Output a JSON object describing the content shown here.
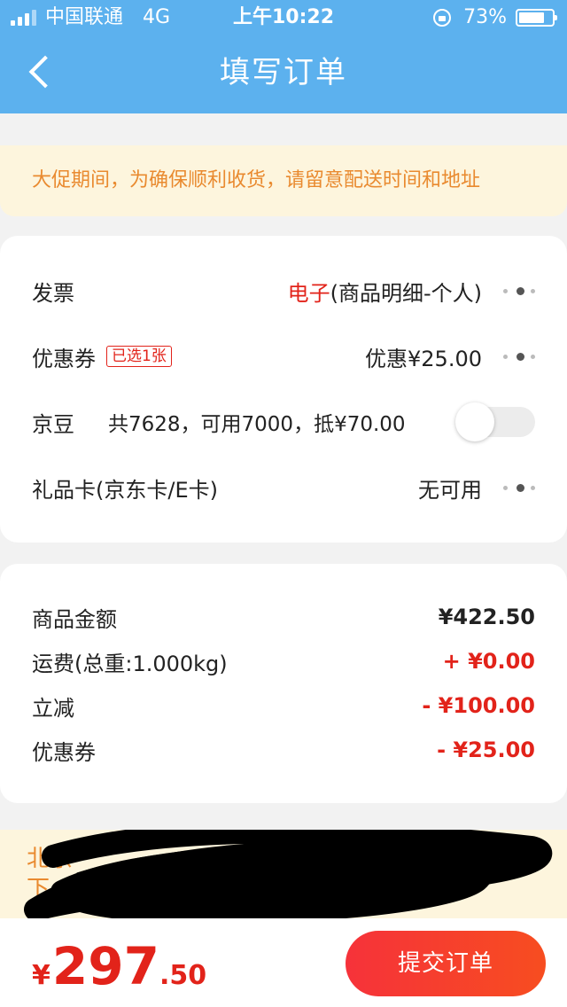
{
  "status_bar": {
    "carrier": "中国联通",
    "network": "4G",
    "time": "上午10:22",
    "battery": "73%"
  },
  "header": {
    "title": "填写订单"
  },
  "notice": "大促期间，为确保顺利收货，请留意配送时间和地址",
  "options": {
    "invoice": {
      "label": "发票",
      "value_highlight": "电子",
      "value_rest": "(商品明细-个人)"
    },
    "coupon": {
      "label": "优惠券",
      "badge": "已选1张",
      "value": "优惠¥25.00"
    },
    "beans": {
      "label": "京豆",
      "info": "共7628，可用7000，抵¥70.00",
      "enabled": false
    },
    "gift_card": {
      "label": "礼品卡(京东卡/E卡)",
      "value": "无可用"
    }
  },
  "summary": {
    "goods": {
      "label": "商品金额",
      "amount": "¥422.50"
    },
    "shipping": {
      "label": "运费(总重:1.000kg)",
      "amount": "+ ¥0.00"
    },
    "discount": {
      "label": "立减",
      "amount": "- ¥100.00"
    },
    "coupon": {
      "label": "优惠券",
      "amount": "- ¥25.00"
    }
  },
  "address": {
    "line1": "北京",
    "line2": "下"
  },
  "bottom": {
    "currency": "¥",
    "total_int": "297",
    "total_dec": ".50",
    "submit_label": "提交订单"
  },
  "colors": {
    "header_bg": "#5cb1ee",
    "accent_red": "#e2231a",
    "notice_text": "#e98a2f",
    "notice_bg": "#fdf5dd"
  }
}
